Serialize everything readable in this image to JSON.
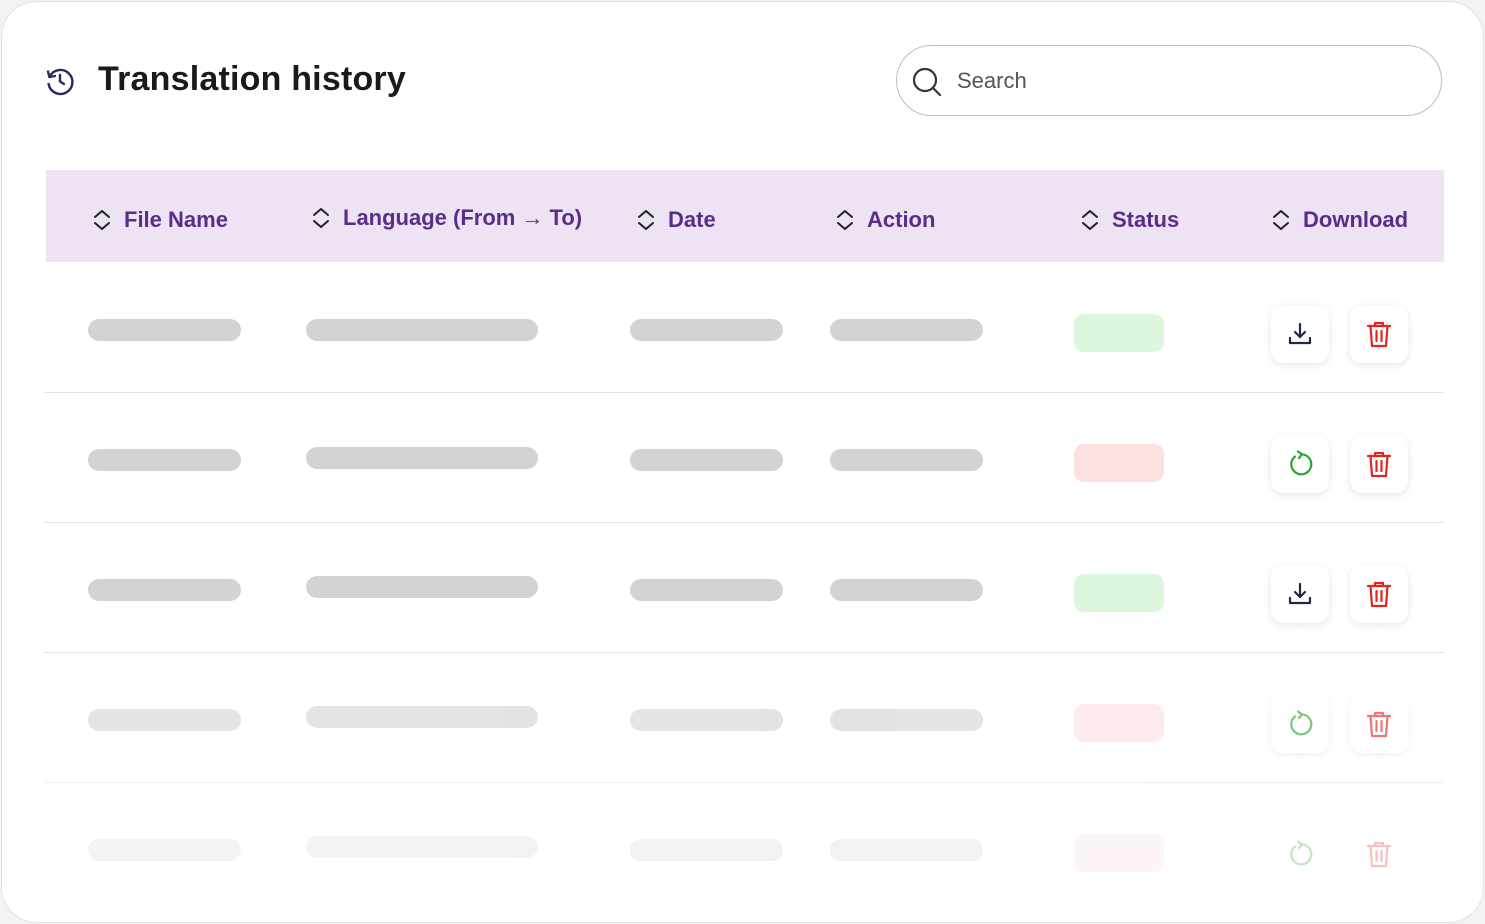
{
  "header": {
    "title": "Translation history",
    "icon": "history-icon",
    "search_placeholder": "Search"
  },
  "table": {
    "columns": [
      "File Name",
      "Language (From → To)",
      "Date",
      "Action",
      "Status",
      "Download"
    ],
    "rows": [
      {
        "status": "success",
        "primary_action": "download-icon",
        "secondary_action": "trash-icon"
      },
      {
        "status": "failed",
        "primary_action": "retry-icon",
        "secondary_action": "trash-icon"
      },
      {
        "status": "success",
        "primary_action": "download-icon",
        "secondary_action": "trash-icon"
      },
      {
        "status": "failed",
        "primary_action": "retry-icon",
        "secondary_action": "trash-icon"
      },
      {
        "status": "failed",
        "primary_action": "retry-icon",
        "secondary_action": "trash-icon"
      }
    ]
  },
  "colors": {
    "accent": "#5b2d8a",
    "header_bg": "#ede3f2",
    "success_pill": "#dcf7dd",
    "failed_pill": "#fde0e0",
    "trash": "#e0271f",
    "retry": "#2aa52e",
    "download": "#1f2a44",
    "skeleton": "#d3d3d3"
  }
}
